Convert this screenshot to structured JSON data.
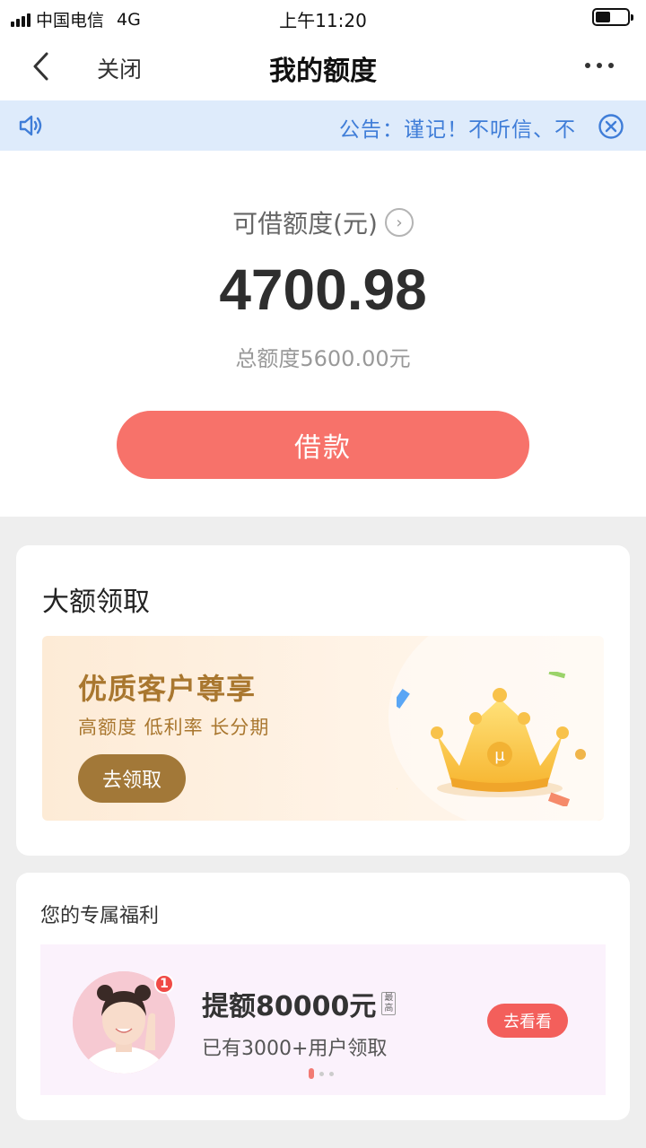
{
  "status_bar": {
    "carrier": "中国电信",
    "network": "4G",
    "time": "上午11:20"
  },
  "nav": {
    "close_label": "关闭",
    "title": "我的额度"
  },
  "notice": {
    "text": "公告：谨记！不听信、不"
  },
  "credit": {
    "available_label": "可借额度(元)",
    "available_amount": "4700.98",
    "total_amount": "总额度5600.00元",
    "borrow_button": "借款"
  },
  "large_claim": {
    "title": "大额领取",
    "banner_heading": "优质客户尊享",
    "banner_sub": "高额度 低利率 长分期",
    "claim_button": "去领取",
    "crown_letter": "μ"
  },
  "benefits": {
    "title": "您的专属福利",
    "badge_count": "1",
    "heading": "提额80000元",
    "max_tag": "最高",
    "sub": "已有3000+用户领取",
    "view_button": "去看看"
  },
  "colors": {
    "accent": "#f7726a",
    "notice_bg": "#deebfb",
    "notice_text": "#3f7dd8",
    "gold": "#a9772f"
  }
}
